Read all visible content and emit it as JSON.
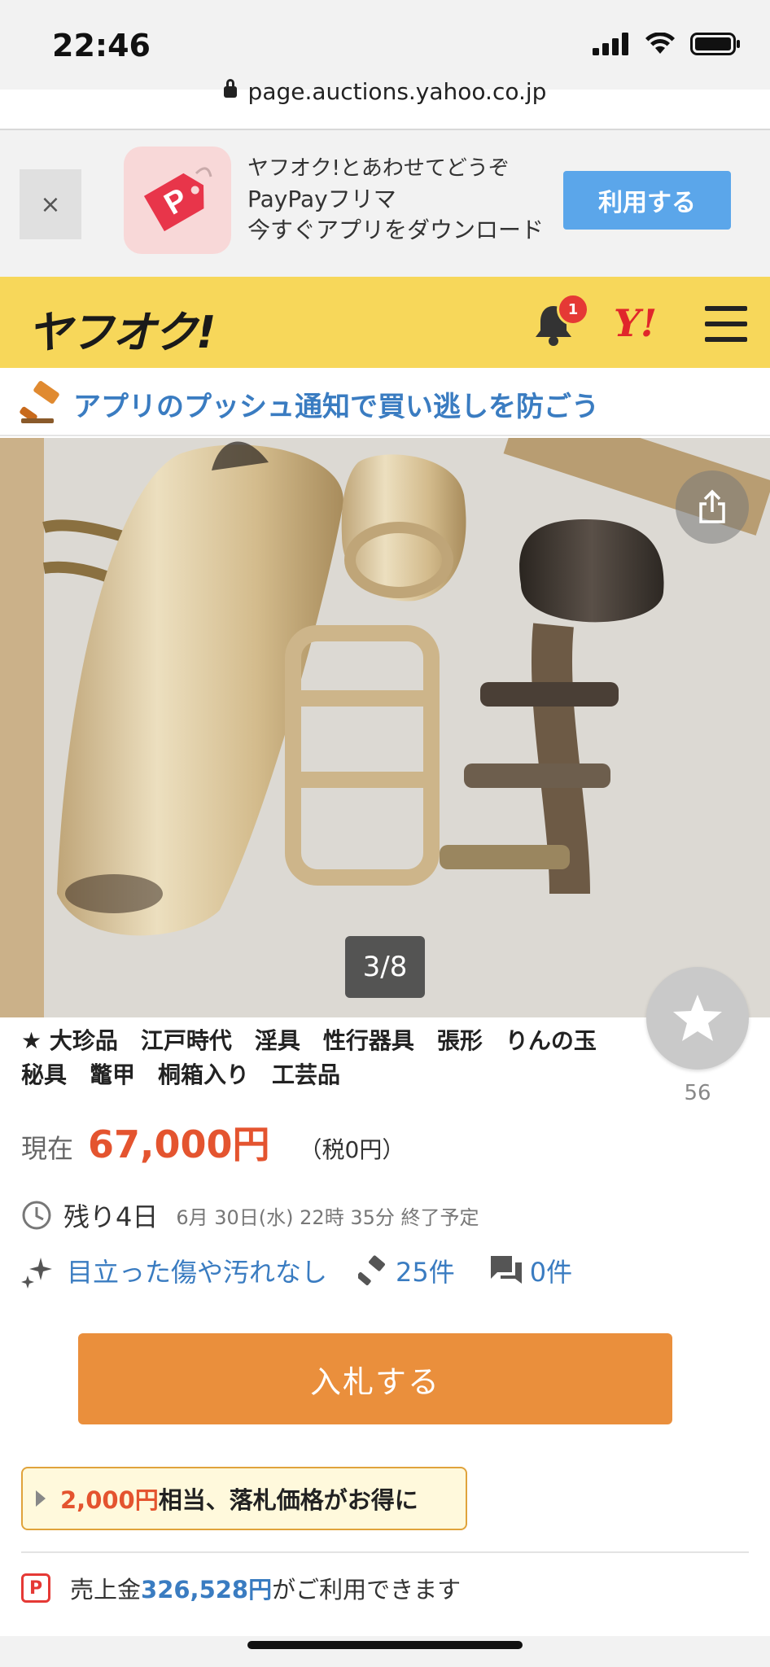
{
  "status_bar": {
    "time": "22:46",
    "url": "page.auctions.yahoo.co.jp"
  },
  "app_banner": {
    "close": "×",
    "line1": "ヤフオク!とあわせてどうぞ",
    "line2": "PayPayフリマ",
    "line3": "今すぐアプリをダウンロード",
    "button": "利用する"
  },
  "header": {
    "logo": "ヤフオク!",
    "notification_count": "1",
    "yahoo_logo": "Y!"
  },
  "push_banner": {
    "text": "アプリのプッシュ通知で買い逃しを防ごう"
  },
  "gallery": {
    "counter": "3/8"
  },
  "watch": {
    "count": "56"
  },
  "item": {
    "title": "★ 大珍品　江戸時代　淫具　性行器具　張形　りんの玉　秘具　鼈甲　桐箱入り　工芸品",
    "price_label": "現在",
    "price": "67,000円",
    "tax": "（税0円）",
    "time_left": "残り4日",
    "end_time": "6月 30日(水) 22時 35分 終了予定",
    "condition": "目立った傷や汚れなし",
    "bids": "25件",
    "questions": "0件"
  },
  "bid_button": {
    "label": "入札する"
  },
  "promo": {
    "amount": "2,000円",
    "text": "相当、落札価格がお得に"
  },
  "sales": {
    "prefix": "売上金",
    "amount": "326,528円",
    "suffix": "がご利用できます"
  },
  "colors": {
    "header": "#f7d75a",
    "price": "#e4542f",
    "link": "#3a7cc1",
    "bid_button": "#ea8f3c",
    "banner_button": "#5ba6ea"
  }
}
